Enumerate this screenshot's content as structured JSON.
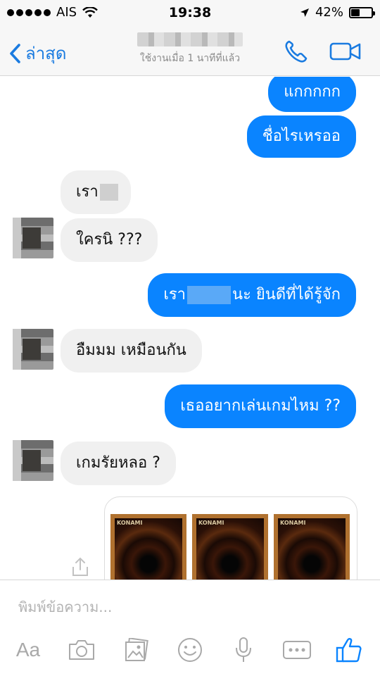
{
  "status_bar": {
    "carrier": "AIS",
    "time": "19:38",
    "battery_text": "42%",
    "battery_level": 0.42
  },
  "nav": {
    "back_label": "ล่าสุด",
    "status_text": "ใช้งานเมื่อ 1 นาทีที่แล้ว",
    "icons": [
      "chevron-left-icon",
      "phone-icon",
      "video-camera-icon"
    ]
  },
  "messages": {
    "m1": "แกกกกก",
    "m2": "ชื่อไรเหรออ",
    "m3_prefix": "เรา",
    "m4": "ใครนิ ???",
    "m5_prefix": "เรา",
    "m5_suffix": "นะ ยินดีที่ได้รู้จัก",
    "m6": "อืมมม เหมือนกัน",
    "m7": "เธออยากเล่นเกมไหม ??",
    "m8": "เกมรัยหลอ ?",
    "card_brand": "KONAMI"
  },
  "composer": {
    "placeholder": "พิมพ์ข้อความ...",
    "aa_label": "Aa",
    "icons": [
      "camera-icon",
      "gallery-icon",
      "emoji-icon",
      "microphone-icon",
      "more-icon",
      "thumbs-up-icon"
    ]
  },
  "colors": {
    "accent": "#0a84ff",
    "incoming_bubble": "#f0f0f0",
    "nav_background": "#f7f7f7"
  }
}
